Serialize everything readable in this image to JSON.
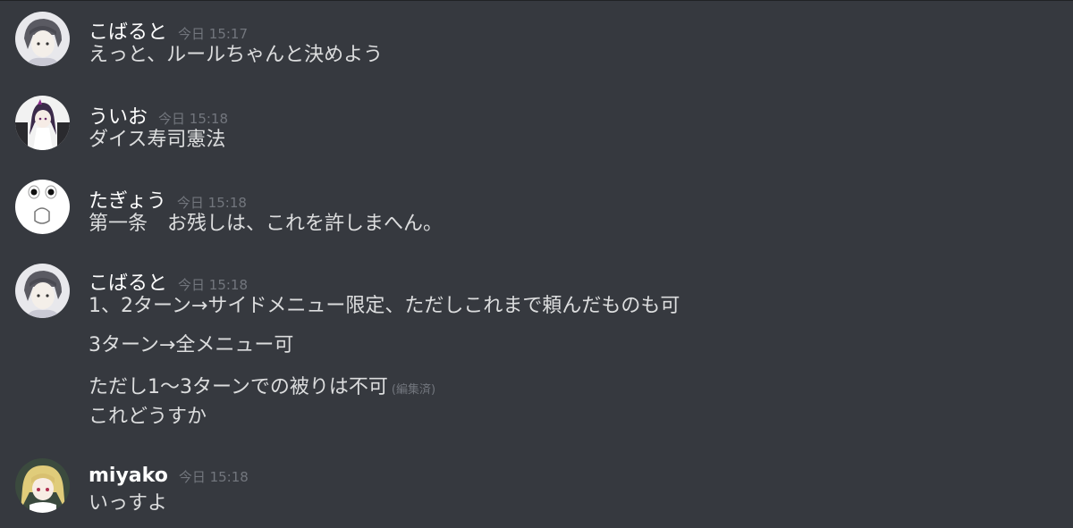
{
  "messages": [
    {
      "author": "こばると",
      "timestamp": "今日 15:17",
      "avatar": "kobaruto-avatar",
      "lines": [
        "えっと、ルールちゃんと決めよう"
      ]
    },
    {
      "author": "ういお",
      "timestamp": "今日 15:18",
      "avatar": "uio-avatar",
      "lines": [
        "ダイス寿司憲法"
      ]
    },
    {
      "author": "たぎょう",
      "timestamp": "今日 15:18",
      "avatar": "tagyou-avatar",
      "lines": [
        "第一条　お残しは、これを許しまへん。"
      ]
    },
    {
      "author": "こばると",
      "timestamp": "今日 15:18",
      "avatar": "kobaruto-avatar",
      "lines": [
        "1、2ターン→サイドメニュー限定、ただしこれまで頼んだものも可",
        "3ターン→全メニュー可",
        "ただし1〜3ターンでの被りは不可",
        "これどうすか"
      ],
      "edited_label": "(編集済)"
    },
    {
      "author": "miyako",
      "timestamp": "今日 15:18",
      "avatar": "miyako-avatar",
      "lines": [
        "いっすよ"
      ]
    }
  ],
  "colors": {
    "background": "#36393f",
    "username": "#ffffff",
    "text": "#dcddde",
    "timestamp": "#72767d"
  }
}
